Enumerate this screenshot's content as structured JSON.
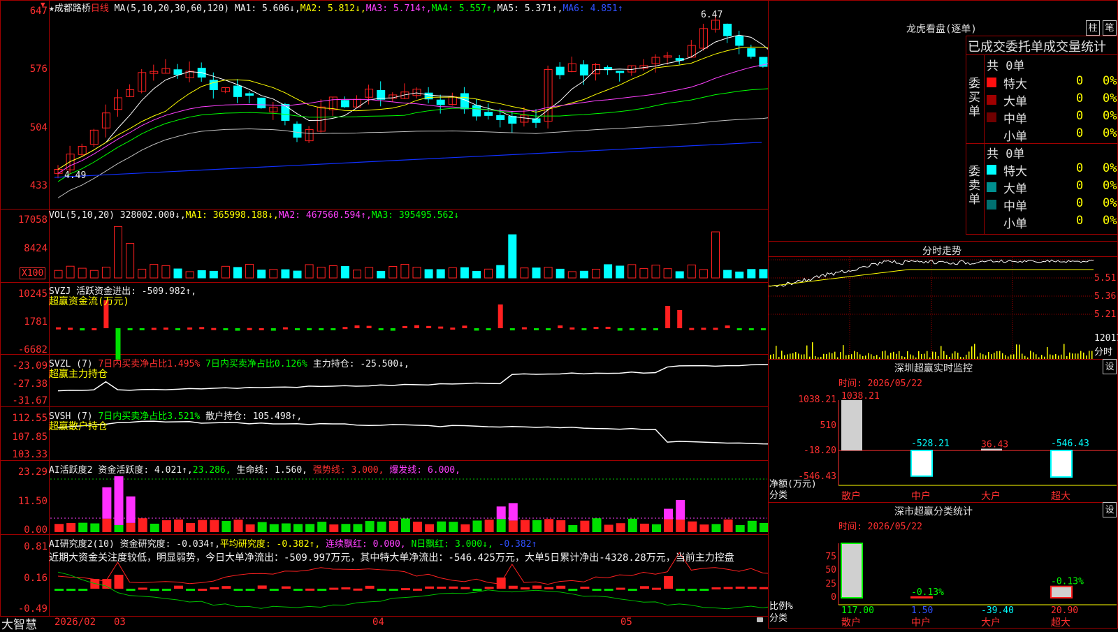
{
  "app": {
    "brand": "大智慧"
  },
  "kline": {
    "title_prefix": "★成都路桥",
    "period": "日线",
    "ma_params": "MA(5,10,20,30,60,120)",
    "ma1": "MA1: 5.606↓,",
    "ma2": "MA2: 5.812↓,",
    "ma3": "MA3: 5.714↑,",
    "ma4": "MA4: 5.557↑,",
    "ma5": "MA5: 5.371↑,",
    "ma6": "MA6: 4.851↑",
    "axis": [
      "647",
      "576",
      "504",
      "433"
    ],
    "high_label": "6.47",
    "low_label": "4.49",
    "colors": {
      "up": "#ff2020",
      "down": "#00ffff",
      "ma1": "#ffffff",
      "ma2": "#ffff00",
      "ma3": "#ff40ff",
      "ma4": "#00ff00",
      "ma5": "#c0c0c0",
      "ma6": "#1030ff"
    }
  },
  "vol": {
    "params": "VOL(5,10,20)",
    "value": "328002.000↓,",
    "ma1": "MA1: 365998.188↓,",
    "ma2": "MA2: 467560.594↑,",
    "ma3": "MA3: 395495.562↓",
    "axis": [
      "17058",
      "8424"
    ],
    "unit": "X100"
  },
  "svzj": {
    "name": "SVZJ",
    "label": "活跃资金进出: -509.982↑,",
    "title": "超赢资金流(万元)",
    "axis": [
      "10245",
      "1781",
      "-6682"
    ]
  },
  "svzl": {
    "name": "SVZL (7)",
    "t1": "7日内买卖净占比1.495%",
    "t2": "7日内买卖净占比0.126%",
    "t3": "主力持仓: -25.500↓,",
    "title": "超赢主力持仓",
    "axis": [
      "-23.09",
      "-27.38",
      "-31.67"
    ]
  },
  "svsh": {
    "name": "SVSH (7)",
    "t1": "7日内买卖净占比3.521%",
    "t2": "散户持仓: 105.498↑,",
    "title": "超赢散户持仓",
    "axis": [
      "112.55",
      "107.85",
      "103.33"
    ]
  },
  "ai1": {
    "name": "AI活跃度2",
    "t1": "资金活跃度: 4.021↑,",
    "t2": "23.286,",
    "t3": "生命线: 1.560,",
    "t4": "强势线: 3.000,",
    "t5": "爆发线: 6.000,",
    "axis": [
      "23.29",
      "11.50",
      "0.00"
    ]
  },
  "ai2": {
    "name": "AI研究度2(10)",
    "t1": "资金研究度: -0.034↑,",
    "t2": "平均研究度: -0.382↑,",
    "t3": "连续飘红: 0.000,",
    "t4": "N日飘红: 3.000↓,",
    "t5": "-0.382↑",
    "commentary": "近期大资金关注度较低，明显弱势，今日大单净流出：-509.997万元，其中特大单净流出：-546.425万元，大单5日累计净出-4328.28万元，当前主力控盘",
    "axis": [
      "0.81",
      "0.16",
      "-0.49"
    ]
  },
  "timeline": {
    "year_label": "2026/02",
    "m3": "03",
    "m4": "04",
    "m5": "05"
  },
  "longhu": {
    "title": "龙虎看盘(逐单)",
    "btn1": "柱",
    "btn2": "笔",
    "subtitle": "已成交委托单成交量统计",
    "buy_total": "共 0单",
    "buy_label": "委买单",
    "sell_total": "共 0单",
    "sell_label": "委卖单",
    "buy_rows": [
      {
        "name": "特大",
        "color": "#ff1010",
        "value": "0",
        "pct": "0%"
      },
      {
        "name": "大单",
        "color": "#a00000",
        "value": "0",
        "pct": "0%"
      },
      {
        "name": "中单",
        "color": "#700000",
        "value": "0",
        "pct": "0%"
      },
      {
        "name": "小单",
        "color": "#000000",
        "value": "0",
        "pct": "0%"
      }
    ],
    "sell_rows": [
      {
        "name": "特大",
        "color": "#00ffff",
        "value": "0",
        "pct": "0%"
      },
      {
        "name": "大单",
        "color": "#009090",
        "value": "0",
        "pct": "0%"
      },
      {
        "name": "中单",
        "color": "#007070",
        "value": "0",
        "pct": "0%"
      },
      {
        "name": "小单",
        "color": "#000000",
        "value": "0",
        "pct": "0%"
      }
    ]
  },
  "intraday": {
    "title": "分时走势",
    "axis": [
      "5.51",
      "5.36",
      "5.21"
    ],
    "vol_label": "12017",
    "footer": "分时"
  },
  "monitor": {
    "title": "深圳超赢实时监控",
    "btn": "设",
    "time": "时间: 2026/05/22",
    "axis": [
      "1038.21",
      "510",
      "-18.20",
      "-546.43"
    ],
    "ylabel": "净额(万元)",
    "xlabel": "分类",
    "bars": [
      {
        "cat": "散户",
        "value": "1038.21",
        "num": 1038.21
      },
      {
        "cat": "中户",
        "value": "-528.21",
        "num": -528.21
      },
      {
        "cat": "大户",
        "value": "36.43",
        "num": 36.43
      },
      {
        "cat": "超大",
        "value": "-546.43",
        "num": -546.43
      }
    ]
  },
  "stats": {
    "title": "深市超赢分类统计",
    "btn": "设",
    "time": "时间: 2026/05/22",
    "axis": [
      "75",
      "50",
      "25",
      "0"
    ],
    "ylabel": "比例%",
    "xlabel": "分类",
    "bars": [
      {
        "cat": "散户",
        "value": "117.00",
        "label": "",
        "num": 100
      },
      {
        "cat": "中户",
        "value": "1.50",
        "label": "-0.13%",
        "num": 1.5
      },
      {
        "cat": "大户",
        "value": "-39.40",
        "label": "",
        "num": 0
      },
      {
        "cat": "超大",
        "value": "20.90",
        "label": "-0.13%",
        "num": 20.9
      }
    ]
  }
}
